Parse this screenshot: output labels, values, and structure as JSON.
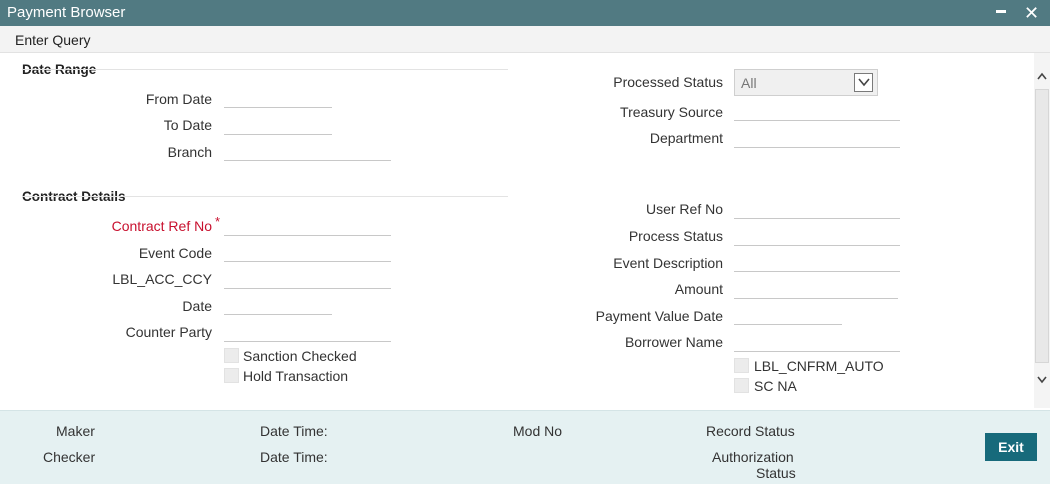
{
  "window": {
    "title": "Payment Browser"
  },
  "menu": {
    "enter_query": "Enter Query"
  },
  "date_range": {
    "section_title": "Date Range",
    "from_date_label": "From Date",
    "from_date_value": "",
    "to_date_label": "To Date",
    "to_date_value": "",
    "branch_label": "Branch",
    "branch_value": ""
  },
  "right_top": {
    "processed_status_label": "Processed Status",
    "processed_status_value": "All",
    "treasury_source_label": "Treasury Source",
    "treasury_source_value": "",
    "department_label": "Department",
    "department_value": ""
  },
  "contract_details": {
    "section_title": "Contract Details",
    "contract_ref_label": "Contract Ref No",
    "contract_ref_required": "*",
    "contract_ref_value": "",
    "event_code_label": "Event Code",
    "event_code_value": "",
    "acc_ccy_label": "LBL_ACC_CCY",
    "acc_ccy_value": "",
    "date_label": "Date",
    "date_value": "",
    "counter_party_label": "Counter Party",
    "counter_party_value": "",
    "sanction_checked_label": "Sanction Checked",
    "hold_transaction_label": "Hold Transaction"
  },
  "right_bottom": {
    "user_ref_label": "User Ref No",
    "user_ref_value": "",
    "process_status_label": "Process Status",
    "process_status_value": "",
    "event_description_label": "Event Description",
    "event_description_value": "",
    "amount_label": "Amount",
    "amount_value": "",
    "payment_value_date_label": "Payment Value Date",
    "payment_value_date_value": "",
    "borrower_name_label": "Borrower Name",
    "borrower_name_value": "",
    "cnfrm_auto_label": "LBL_CNFRM_AUTO",
    "sc_na_label": "SC NA"
  },
  "footer": {
    "maker_label": "Maker",
    "checker_label": "Checker",
    "maker_date_time_label": "Date Time:",
    "checker_date_time_label": "Date Time:",
    "mod_no_label": "Mod No",
    "record_status_label": "Record Status",
    "authorization_label": "Authorization",
    "status_label": "Status",
    "exit_label": "Exit"
  },
  "colors": {
    "title_bar": "#517a82",
    "footer_bg": "#e5f1f2",
    "exit_button": "#176a7b",
    "required_label": "#c8102e"
  },
  "icons": {
    "minimize": "minimize-icon",
    "close": "close-icon",
    "dropdown": "chevron-down-icon",
    "scroll_up": "chevron-up-icon",
    "scroll_down": "chevron-down-icon"
  }
}
